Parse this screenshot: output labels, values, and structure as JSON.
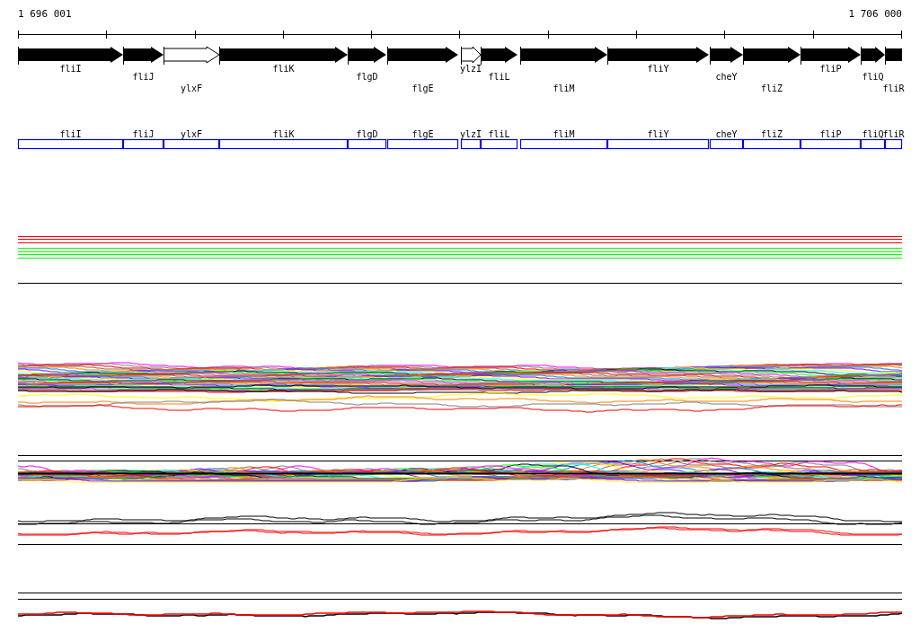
{
  "coordinates": {
    "start": "1 696 001",
    "end": "1 706 000"
  },
  "genes": [
    {
      "name": "fliI",
      "kind": "filled"
    },
    {
      "name": "fliJ",
      "kind": "filled"
    },
    {
      "name": "ylxF",
      "kind": "open"
    },
    {
      "name": "fliK",
      "kind": "filled"
    },
    {
      "name": "flgD",
      "kind": "filled"
    },
    {
      "name": "flgE",
      "kind": "filled"
    },
    {
      "name": "ylzI",
      "kind": "open"
    },
    {
      "name": "fliL",
      "kind": "filled"
    },
    {
      "name": "fliM",
      "kind": "filled"
    },
    {
      "name": "fliY",
      "kind": "filled"
    },
    {
      "name": "cheY",
      "kind": "filled"
    },
    {
      "name": "fliZ",
      "kind": "filled"
    },
    {
      "name": "fliP",
      "kind": "filled"
    },
    {
      "name": "fliQ",
      "kind": "filled"
    },
    {
      "name": "fliR",
      "kind": "cut"
    }
  ],
  "gene_boxes": [
    {
      "name": "fliI"
    },
    {
      "name": "fliJ"
    },
    {
      "name": "ylxF"
    },
    {
      "name": "fliK"
    },
    {
      "name": "flgD"
    },
    {
      "name": "flgE"
    },
    {
      "name": "ylzI"
    },
    {
      "name": "fliL"
    },
    {
      "name": "fliM"
    },
    {
      "name": "fliY"
    },
    {
      "name": "cheY"
    },
    {
      "name": "fliZ"
    },
    {
      "name": "fliP"
    },
    {
      "name": "fliQ"
    },
    {
      "name": "fliR"
    }
  ]
}
